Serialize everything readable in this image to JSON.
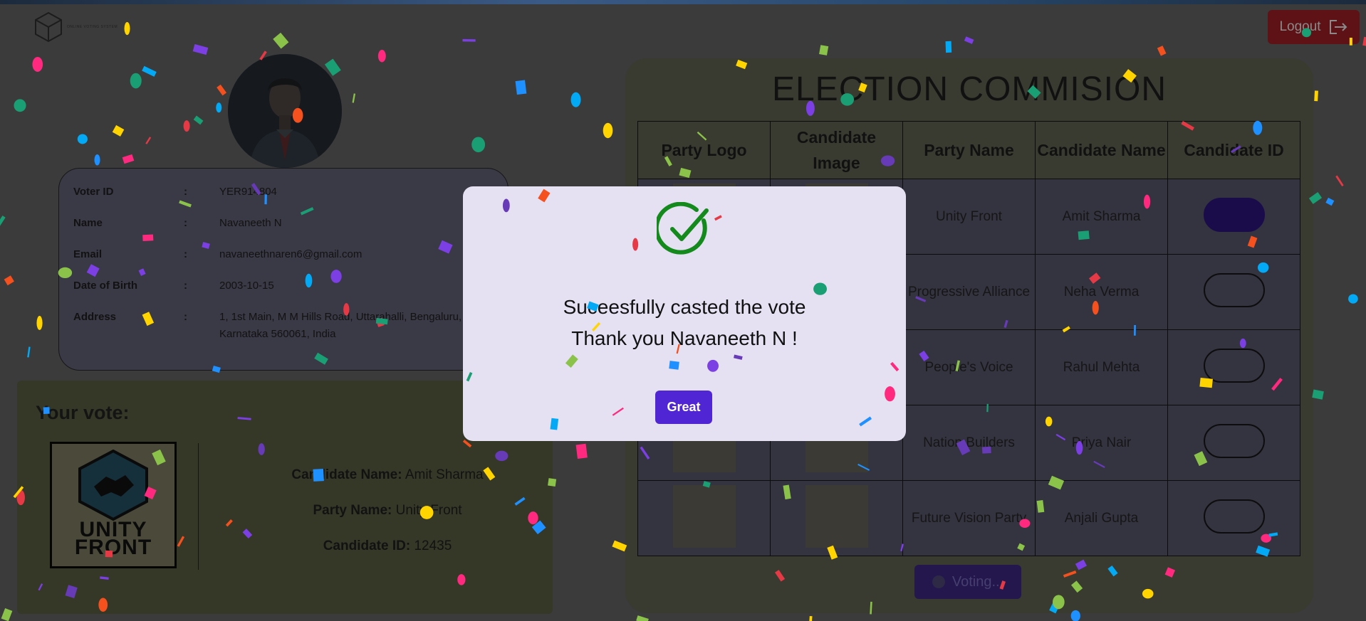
{
  "header": {
    "brand_text": "ONLINE VOTING SYSTEM",
    "logout_label": "Logout"
  },
  "voter": {
    "fields": [
      {
        "label": "Voter ID",
        "value": "YER914804"
      },
      {
        "label": "Name",
        "value": "Navaneeth N"
      },
      {
        "label": "Email",
        "value": "navaneethnaren6@gmail.com"
      },
      {
        "label": "Date of Birth",
        "value": "2003-10-15"
      },
      {
        "label": "Address",
        "value": "1, 1st Main, M M Hills Road, Uttarahalli, Bengaluru, Karnataka 560061, India"
      }
    ],
    "colon": ":"
  },
  "your_vote": {
    "title": "Your vote:",
    "logo_line1": "UNITY",
    "logo_line2": "FRONT",
    "candidate_name_label": "Candidate Name:",
    "candidate_name": "Amit Sharma",
    "party_name_label": "Party Name:",
    "party_name": "Unity Front",
    "candidate_id_label": "Candidate ID:",
    "candidate_id": "12435"
  },
  "election": {
    "title": "ELECTION COMMISION",
    "columns": [
      "Party Logo",
      "Candidate Image",
      "Party Name",
      "Candidate Name",
      "Candidate ID"
    ],
    "rows": [
      {
        "party": "Unity Front",
        "candidate": "Amit Sharma",
        "selected": true
      },
      {
        "party": "Progressive Alliance",
        "candidate": "Neha Verma",
        "selected": false
      },
      {
        "party": "People's Voice",
        "candidate": "Rahul Mehta",
        "selected": false
      },
      {
        "party": "Nation Builders",
        "candidate": "Priya Nair",
        "selected": false
      },
      {
        "party": "Future Vision Party",
        "candidate": "Anjali Gupta",
        "selected": false
      }
    ],
    "voting_label": "Voting..."
  },
  "modal": {
    "line1": "Suceesfully casted the vote",
    "line2": "Thank you Navaneeth N !",
    "button_label": "Great"
  },
  "colors": {
    "accent": "#5025d4",
    "success": "#138a1b",
    "logout": "#5e1216"
  }
}
